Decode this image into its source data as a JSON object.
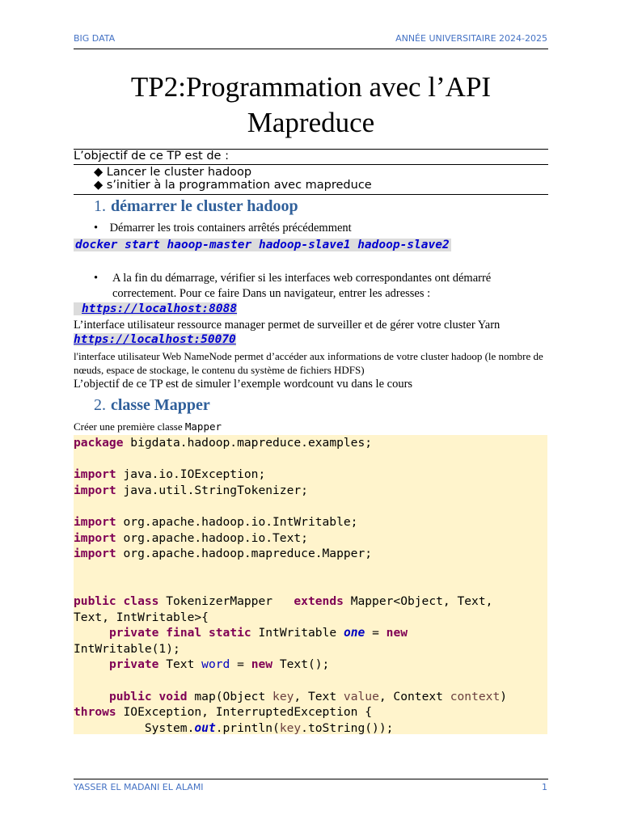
{
  "header": {
    "left": "BIG DATA",
    "right": "ANNÉE UNIVERSITAIRE 2024-2025"
  },
  "title": "TP2:Programmation avec l’API Mapreduce",
  "objective_intro": "L’objectif de ce TP est de :",
  "objectives": [
    "Lancer le cluster hadoop",
    "s’initier à la programmation avec mapreduce"
  ],
  "section1": {
    "num": "1.",
    "title": "démarrer le cluster hadoop",
    "bullet1": "Démarrer les trois containers arrêtés précédemment",
    "command": "docker start haoop-master hadoop-slave1 hadoop-slave2",
    "bullet2": "A la fin du démarrage, vérifier si les interfaces web correspondantes ont démarré correctement. Pour ce faire Dans un navigateur, entrer les adresses :",
    "link1": "https://localhost:8088",
    "link1_desc": "L’interface utilisateur ressource manager permet de surveiller et de gérer votre cluster Yarn",
    "link2": "https://localhost:50070",
    "link2_desc": "l'interface utilisateur Web NameNode permet d’accéder aux informations de votre cluster hadoop (le nombre de nœuds, espace de stockage, le contenu du système de fichiers HDFS)",
    "goal": "L’objectif de ce TP est de simuler l’exemple wordcount vu dans le cours"
  },
  "section2": {
    "num": "2.",
    "title": "classe Mapper",
    "intro": "Créer une première classe ",
    "intro_code": "Mapper"
  },
  "code_lines": [
    [
      [
        "kw",
        "package"
      ],
      [
        "pl",
        " bigdata.hadoop.mapreduce.examples;"
      ]
    ],
    [],
    [
      [
        "kw",
        "import"
      ],
      [
        "pl",
        " java.io.IOException;"
      ]
    ],
    [
      [
        "kw",
        "import"
      ],
      [
        "pl",
        " java.util.StringTokenizer;"
      ]
    ],
    [],
    [
      [
        "kw",
        "import"
      ],
      [
        "pl",
        " org.apache.hadoop.io.IntWritable;"
      ]
    ],
    [
      [
        "kw",
        "import"
      ],
      [
        "pl",
        " org.apache.hadoop.io.Text;"
      ]
    ],
    [
      [
        "kw",
        "import"
      ],
      [
        "pl",
        " org.apache.hadoop.mapreduce.Mapper;"
      ]
    ],
    [],
    [],
    [
      [
        "kw",
        "public"
      ],
      [
        "pl",
        " "
      ],
      [
        "kw",
        "class"
      ],
      [
        "pl",
        " TokenizerMapper   "
      ],
      [
        "kw",
        "extends"
      ],
      [
        "pl",
        " Mapper<Object, Text,"
      ]
    ],
    [
      [
        "pl",
        "Text, IntWritable>{"
      ]
    ],
    [
      [
        "pl",
        "     "
      ],
      [
        "kw",
        "private"
      ],
      [
        "pl",
        " "
      ],
      [
        "kw",
        "final"
      ],
      [
        "pl",
        " "
      ],
      [
        "kw",
        "static"
      ],
      [
        "pl",
        " IntWritable "
      ],
      [
        "sf",
        "one"
      ],
      [
        "pl",
        " = "
      ],
      [
        "kw",
        "new"
      ]
    ],
    [
      [
        "pl",
        "IntWritable(1);"
      ]
    ],
    [
      [
        "pl",
        "     "
      ],
      [
        "kw",
        "private"
      ],
      [
        "pl",
        " Text "
      ],
      [
        "fd",
        "word"
      ],
      [
        "pl",
        " = "
      ],
      [
        "kw",
        "new"
      ],
      [
        "pl",
        " Text();"
      ]
    ],
    [],
    [
      [
        "pl",
        "     "
      ],
      [
        "kw",
        "public"
      ],
      [
        "pl",
        " "
      ],
      [
        "kw",
        "void"
      ],
      [
        "pl",
        " map(Object "
      ],
      [
        "pv",
        "key"
      ],
      [
        "pl",
        ", Text "
      ],
      [
        "pv",
        "value"
      ],
      [
        "pl",
        ", Context "
      ],
      [
        "pv",
        "context"
      ],
      [
        "pl",
        ")"
      ]
    ],
    [
      [
        "kw",
        "throws"
      ],
      [
        "pl",
        " IOException, InterruptedException {"
      ]
    ],
    [
      [
        "pl",
        "          System."
      ],
      [
        "sf",
        "out"
      ],
      [
        "pl",
        ".println("
      ],
      [
        "pv",
        "key"
      ],
      [
        "pl",
        ".toString());"
      ]
    ]
  ],
  "footer": {
    "author": "YASSER EL MADANI EL ALAMI",
    "page": "1"
  }
}
